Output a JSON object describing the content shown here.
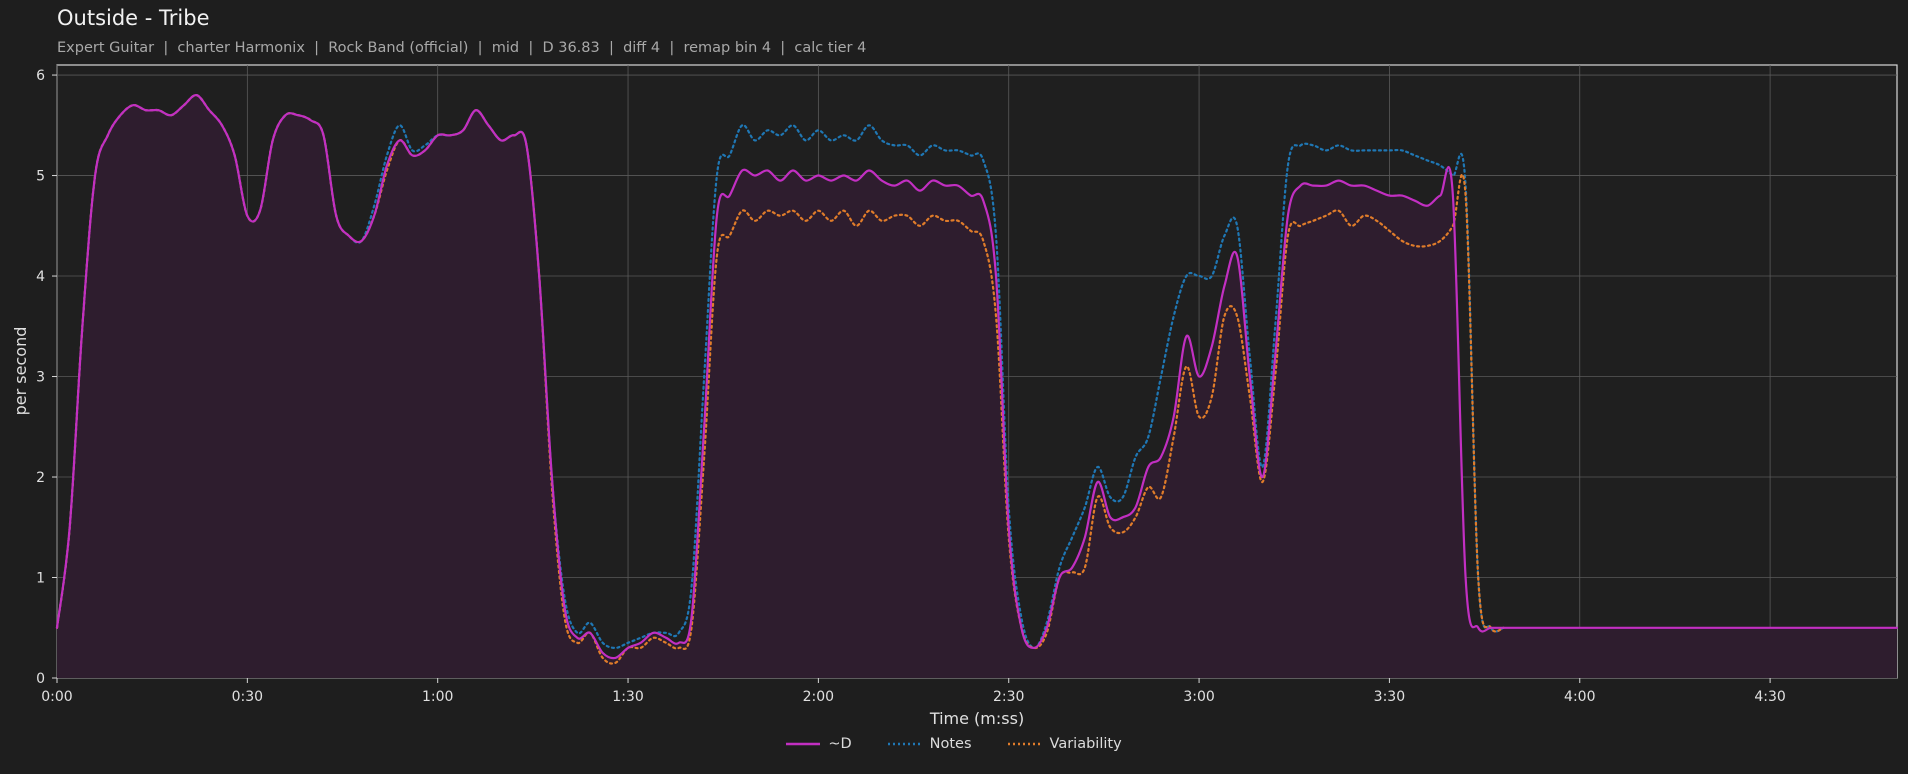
{
  "header": {
    "title": "Outside - Tribe",
    "subtitle": "Expert Guitar  |  charter Harmonix  |  Rock Band (official)  |  mid  |  D 36.83  |  diff 4  |  remap bin 4  |  calc tier 4"
  },
  "colors": {
    "background": "#1e1e1e",
    "plot_bg": "#1f1f1f",
    "grid": "#5a5a5a",
    "d": "#c22fc2",
    "d_fill": "#2e1d2e",
    "notes": "#1f77b4",
    "variability": "#e07c2a"
  },
  "chart_data": {
    "type": "line",
    "xlabel": "Time (m:ss)",
    "ylabel": "per second",
    "xlim": [
      0,
      290
    ],
    "ylim": [
      0,
      6.1
    ],
    "xticks": [
      0,
      30,
      60,
      90,
      120,
      150,
      180,
      210,
      240,
      270
    ],
    "xtick_labels": [
      "0:00",
      "0:30",
      "1:00",
      "1:30",
      "2:00",
      "2:30",
      "3:00",
      "3:30",
      "4:00",
      "4:30"
    ],
    "yticks": [
      0,
      1,
      2,
      3,
      4,
      5,
      6
    ],
    "ytick_labels": [
      "0",
      "1",
      "2",
      "3",
      "4",
      "5",
      "6"
    ],
    "grid": true,
    "legend_position": "bottom-center",
    "series": [
      {
        "name": "~D",
        "style": "solid",
        "x": [
          0,
          2,
          4,
          6,
          8,
          10,
          12,
          14,
          16,
          18,
          20,
          22,
          24,
          26,
          28,
          30,
          32,
          34,
          36,
          38,
          40,
          42,
          44,
          46,
          48,
          50,
          52,
          54,
          56,
          58,
          60,
          62,
          64,
          66,
          68,
          70,
          72,
          74,
          76,
          78,
          80,
          82,
          84,
          86,
          88,
          90,
          92,
          94,
          96,
          98,
          100,
          102,
          104,
          106,
          108,
          110,
          112,
          114,
          116,
          118,
          120,
          122,
          124,
          126,
          128,
          130,
          132,
          134,
          136,
          138,
          140,
          142,
          144,
          146,
          148,
          150,
          152,
          154,
          156,
          158,
          160,
          162,
          164,
          166,
          168,
          170,
          172,
          174,
          176,
          178,
          180,
          182,
          184,
          186,
          188,
          190,
          192,
          194,
          196,
          198,
          200,
          202,
          204,
          206,
          208,
          210,
          212,
          214,
          216,
          218,
          220,
          222,
          224,
          226,
          228,
          230,
          232,
          234,
          236,
          238,
          240,
          242,
          244,
          246,
          248,
          250,
          252,
          254,
          256,
          258,
          260,
          262,
          264,
          266,
          268,
          270,
          272,
          274,
          276,
          278,
          280,
          282,
          284,
          286,
          288,
          290
        ],
        "values": [
          0.5,
          1.5,
          3.5,
          5.0,
          5.4,
          5.6,
          5.7,
          5.65,
          5.65,
          5.6,
          5.7,
          5.8,
          5.65,
          5.5,
          5.2,
          4.6,
          4.65,
          5.35,
          5.6,
          5.6,
          5.55,
          5.4,
          4.6,
          4.4,
          4.35,
          4.6,
          5.1,
          5.35,
          5.2,
          5.25,
          5.4,
          5.4,
          5.45,
          5.65,
          5.5,
          5.35,
          5.4,
          5.3,
          4.0,
          2.0,
          0.7,
          0.4,
          0.45,
          0.25,
          0.2,
          0.3,
          0.35,
          0.45,
          0.4,
          0.35,
          0.6,
          2.5,
          4.6,
          4.8,
          5.05,
          5.0,
          5.05,
          4.95,
          5.05,
          4.95,
          5.0,
          4.95,
          5.0,
          4.95,
          5.05,
          4.95,
          4.9,
          4.95,
          4.85,
          4.95,
          4.9,
          4.9,
          4.8,
          4.75,
          4.0,
          1.5,
          0.5,
          0.3,
          0.5,
          1.0,
          1.1,
          1.4,
          1.95,
          1.6,
          1.6,
          1.7,
          2.1,
          2.2,
          2.6,
          3.4,
          3.0,
          3.3,
          3.9,
          4.2,
          3.0,
          2.0,
          3.2,
          4.6,
          4.9,
          4.9,
          4.9,
          4.95,
          4.9,
          4.9,
          4.85,
          4.8,
          4.8,
          4.75,
          4.7,
          4.8,
          4.8,
          1.0,
          0.5,
          0.5,
          0.5,
          0.5,
          0.5,
          0.5,
          0.5,
          0.5,
          0.5,
          0.5,
          0.5,
          0.5,
          0.5,
          0.5,
          0.5,
          0.5,
          0.5,
          0.5,
          0.5,
          0.5,
          0.5,
          0.5,
          0.5,
          0.5,
          0.5,
          0.5,
          0.5,
          0.5,
          0.5,
          0.5,
          0.5,
          0.5,
          0.5,
          0.5
        ]
      },
      {
        "name": "Notes",
        "style": "dotted",
        "x": [
          0,
          2,
          4,
          6,
          8,
          10,
          12,
          14,
          16,
          18,
          20,
          22,
          24,
          26,
          28,
          30,
          32,
          34,
          36,
          38,
          40,
          42,
          44,
          46,
          48,
          50,
          52,
          54,
          56,
          58,
          60,
          62,
          64,
          66,
          68,
          70,
          72,
          74,
          76,
          78,
          80,
          82,
          84,
          86,
          88,
          90,
          92,
          94,
          96,
          98,
          100,
          102,
          104,
          106,
          108,
          110,
          112,
          114,
          116,
          118,
          120,
          122,
          124,
          126,
          128,
          130,
          132,
          134,
          136,
          138,
          140,
          142,
          144,
          146,
          148,
          150,
          152,
          154,
          156,
          158,
          160,
          162,
          164,
          166,
          168,
          170,
          172,
          174,
          176,
          178,
          180,
          182,
          184,
          186,
          188,
          190,
          192,
          194,
          196,
          198,
          200,
          202,
          204,
          206,
          208,
          210,
          212,
          214,
          216,
          218,
          220,
          222,
          224,
          226,
          228
        ],
        "values": [
          0.5,
          1.5,
          3.5,
          5.0,
          5.4,
          5.6,
          5.7,
          5.65,
          5.65,
          5.6,
          5.7,
          5.8,
          5.65,
          5.5,
          5.2,
          4.6,
          4.65,
          5.35,
          5.6,
          5.6,
          5.55,
          5.4,
          4.6,
          4.4,
          4.35,
          4.7,
          5.2,
          5.5,
          5.25,
          5.3,
          5.4,
          5.4,
          5.45,
          5.65,
          5.5,
          5.35,
          5.4,
          5.3,
          4.0,
          2.0,
          0.8,
          0.45,
          0.55,
          0.35,
          0.3,
          0.35,
          0.4,
          0.45,
          0.45,
          0.45,
          0.9,
          3.0,
          5.0,
          5.2,
          5.5,
          5.35,
          5.45,
          5.4,
          5.5,
          5.35,
          5.45,
          5.35,
          5.4,
          5.35,
          5.5,
          5.35,
          5.3,
          5.3,
          5.2,
          5.3,
          5.25,
          5.25,
          5.2,
          5.15,
          4.4,
          1.7,
          0.6,
          0.3,
          0.55,
          1.1,
          1.4,
          1.7,
          2.1,
          1.8,
          1.8,
          2.2,
          2.4,
          3.0,
          3.6,
          4.0,
          4.0,
          4.0,
          4.4,
          4.5,
          3.2,
          2.1,
          3.5,
          5.1,
          5.3,
          5.3,
          5.25,
          5.3,
          5.25,
          5.25,
          5.25,
          5.25,
          5.25,
          5.2,
          5.15,
          5.1,
          5.0,
          4.9,
          1.0,
          0.5,
          0.5
        ]
      },
      {
        "name": "Variability",
        "style": "dotted",
        "x": [
          0,
          2,
          4,
          6,
          8,
          10,
          12,
          14,
          16,
          18,
          20,
          22,
          24,
          26,
          28,
          30,
          32,
          34,
          36,
          38,
          40,
          42,
          44,
          46,
          48,
          50,
          52,
          54,
          56,
          58,
          60,
          62,
          64,
          66,
          68,
          70,
          72,
          74,
          76,
          78,
          80,
          82,
          84,
          86,
          88,
          90,
          92,
          94,
          96,
          98,
          100,
          102,
          104,
          106,
          108,
          110,
          112,
          114,
          116,
          118,
          120,
          122,
          124,
          126,
          128,
          130,
          132,
          134,
          136,
          138,
          140,
          142,
          144,
          146,
          148,
          150,
          152,
          154,
          156,
          158,
          160,
          162,
          164,
          166,
          168,
          170,
          172,
          174,
          176,
          178,
          180,
          182,
          184,
          186,
          188,
          190,
          192,
          194,
          196,
          198,
          200,
          202,
          204,
          206,
          208,
          210,
          212,
          214,
          216,
          218,
          220,
          222,
          224,
          226,
          228
        ],
        "values": [
          0.5,
          1.5,
          3.5,
          5.0,
          5.4,
          5.6,
          5.7,
          5.65,
          5.65,
          5.6,
          5.7,
          5.8,
          5.65,
          5.5,
          5.2,
          4.6,
          4.65,
          5.35,
          5.6,
          5.6,
          5.55,
          5.4,
          4.6,
          4.4,
          4.35,
          4.6,
          5.05,
          5.35,
          5.2,
          5.25,
          5.4,
          5.4,
          5.45,
          5.65,
          5.5,
          5.35,
          5.4,
          5.3,
          4.0,
          1.9,
          0.6,
          0.35,
          0.45,
          0.2,
          0.15,
          0.3,
          0.3,
          0.4,
          0.35,
          0.3,
          0.5,
          2.2,
          4.2,
          4.4,
          4.65,
          4.55,
          4.65,
          4.6,
          4.65,
          4.55,
          4.65,
          4.55,
          4.65,
          4.5,
          4.65,
          4.55,
          4.6,
          4.6,
          4.5,
          4.6,
          4.55,
          4.55,
          4.45,
          4.35,
          3.6,
          1.4,
          0.5,
          0.3,
          0.45,
          1.0,
          1.05,
          1.1,
          1.8,
          1.5,
          1.45,
          1.6,
          1.9,
          1.8,
          2.4,
          3.1,
          2.6,
          2.8,
          3.6,
          3.6,
          2.8,
          1.95,
          3.0,
          4.4,
          4.5,
          4.55,
          4.6,
          4.65,
          4.5,
          4.6,
          4.55,
          4.45,
          4.35,
          4.3,
          4.3,
          4.35,
          4.5,
          4.8,
          1.0,
          0.5,
          0.5
        ]
      }
    ]
  }
}
